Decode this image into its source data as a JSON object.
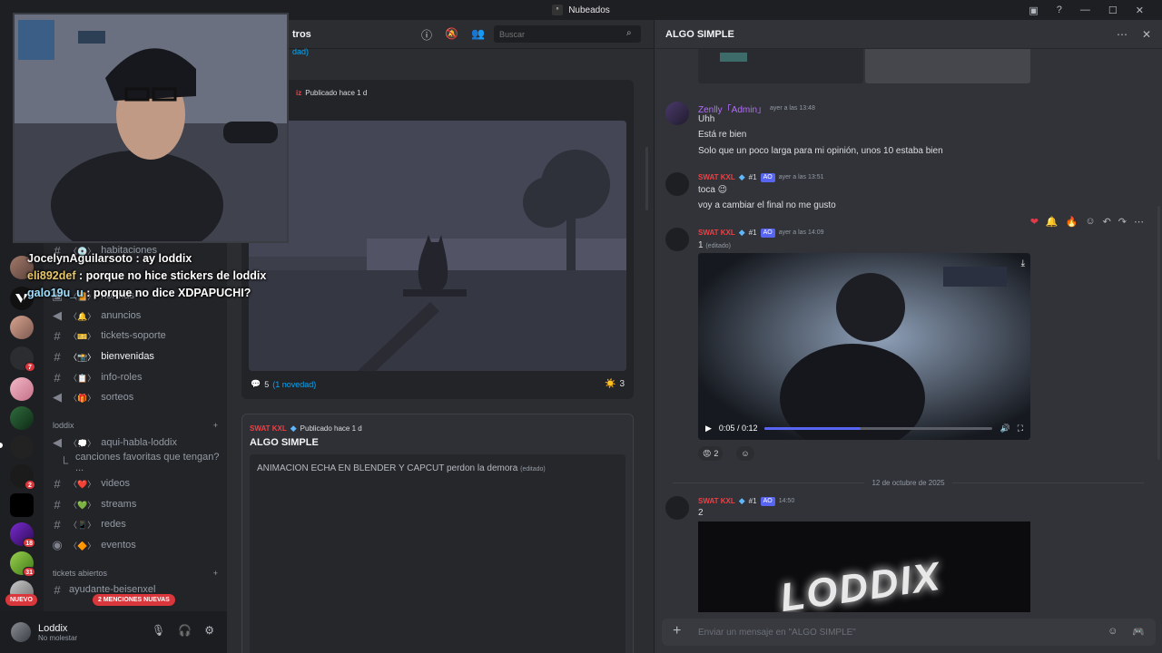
{
  "window": {
    "title": "Nubeados",
    "logo_glyph": "ⁿ",
    "tools": [
      "▣",
      "?",
      "—",
      "☐",
      "✕"
    ]
  },
  "servers": {
    "badges": [
      "7",
      "2",
      "18",
      "31"
    ],
    "new_label": "NUEVO",
    "mentions_label": "2 MENCIONES NUEVAS"
  },
  "sidebar": {
    "channels_top": [
      {
        "label": "habitaciones",
        "emoji": "〈💿〉"
      },
      {
        "label": "normas",
        "emoji": "〈📙〉"
      },
      {
        "label": "anuncios",
        "emoji": "〈🔔〉"
      },
      {
        "label": "tickets-soporte",
        "emoji": "〈🎫〉"
      },
      {
        "label": "bienvenidas",
        "emoji": "〈📸〉"
      },
      {
        "label": "info-roles",
        "emoji": "〈📋〉"
      },
      {
        "label": "sorteos",
        "emoji": "〈🎁〉"
      }
    ],
    "category_1": "loddix",
    "channels_loddix": [
      {
        "label": "aqui-habla-loddix",
        "emoji": "〈💭〉"
      },
      {
        "label": "canciones favoritas que tengan? ...",
        "emoji": ""
      },
      {
        "label": "videos",
        "emoji": "〈❤️〉"
      },
      {
        "label": "streams",
        "emoji": "〈💚〉"
      },
      {
        "label": "redes",
        "emoji": "〈📱〉"
      },
      {
        "label": "eventos",
        "emoji": "〈🔶〉"
      }
    ],
    "category_2": "tickets abiertos",
    "ticket_channel": "ayudante-beisenxel",
    "user": {
      "name": "Loddix",
      "status": "No molestar"
    }
  },
  "forum": {
    "header_title": "tros",
    "header_sub": "dad)",
    "search_placeholder": "Buscar",
    "post1": {
      "author": "iz",
      "published": "Publicado hace 1 d",
      "comments_count": "5",
      "comments_new": "(1 novedad)",
      "reaction_emoji": "☀️",
      "reaction_count": "3"
    },
    "post2": {
      "author": "SWAT KXL",
      "published": "Publicado hace 1 d",
      "title": "ALGO SIMPLE",
      "body": "ANIMACION ECHA EN BLENDER Y CAPCUT perdon la demora",
      "edited": "(editado)"
    }
  },
  "chat": {
    "title": "ALGO SIMPLE",
    "messages": [
      {
        "author": "Zenlly「Admin」",
        "time": "ayer a las 13:48",
        "lines": [
          "Uhh",
          "Está re bien",
          "Solo que un poco larga para mi opinión, unos 10 estaba bien"
        ]
      },
      {
        "author": "SWAT KXL",
        "time": "ayer a las 13:51",
        "lines": [
          "toca 😉",
          "voy a cambiar el final no me gusto"
        ]
      },
      {
        "author": "SWAT KXL",
        "time": "ayer a las 14:09",
        "lines": [
          "1"
        ],
        "edited": "(editado)",
        "video_time": "0:05 / 0:12",
        "video_progress": 0.42,
        "reaction_emoji": "😡",
        "reaction_count": "2"
      },
      {
        "author": "SWAT KXL",
        "time": "14:50",
        "lines": [
          "2"
        ]
      }
    ],
    "tag_rank": "#1",
    "tag_ao": "AO",
    "date_divider": "12 de octubre de 2025",
    "input_placeholder": "Enviar un mensaje en \"ALGO SIMPLE\"",
    "video_wordmark": "LODDIX"
  },
  "stream_overlay": [
    {
      "user": "JocelynAguilarsoto",
      "text": " : ay loddix"
    },
    {
      "user": "eli892def",
      "text": " : porque no hice stickers de loddix"
    },
    {
      "user": "galo19u_u",
      "text": " : porque no dice XDPAPUCHI?"
    }
  ]
}
